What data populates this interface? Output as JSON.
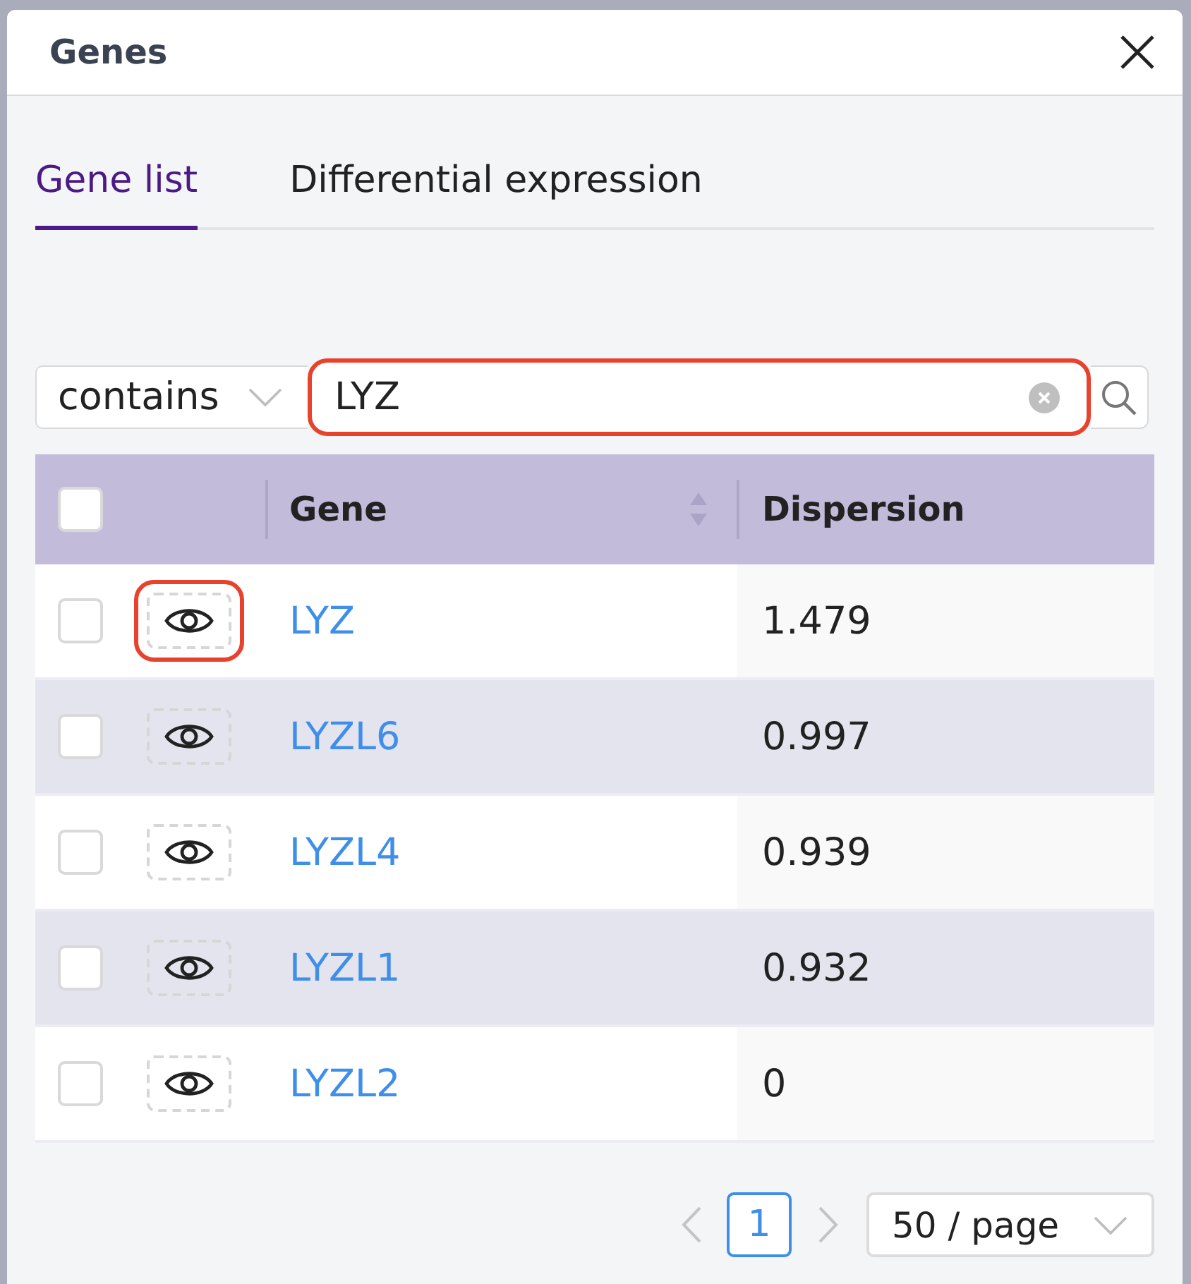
{
  "dialog": {
    "title": "Genes"
  },
  "tabs": [
    {
      "label": "Gene list",
      "selected": true
    },
    {
      "label": "Differential expression",
      "selected": false
    }
  ],
  "filter": {
    "operator": "contains",
    "query": "LYZ",
    "highlighted": true
  },
  "table": {
    "all_checked": false,
    "columns": [
      {
        "label": "Gene",
        "sortable": true
      },
      {
        "label": "Dispersion",
        "sortable": false
      }
    ],
    "rows": [
      {
        "checked": false,
        "highlighted": true,
        "gene": "LYZ",
        "dispersion": "1.479"
      },
      {
        "checked": false,
        "highlighted": false,
        "gene": "LYZL6",
        "dispersion": "0.997"
      },
      {
        "checked": false,
        "highlighted": false,
        "gene": "LYZL4",
        "dispersion": "0.939"
      },
      {
        "checked": false,
        "highlighted": false,
        "gene": "LYZL1",
        "dispersion": "0.932"
      },
      {
        "checked": false,
        "highlighted": false,
        "gene": "LYZL2",
        "dispersion": "0"
      }
    ]
  },
  "pagination": {
    "pages": [
      {
        "label": "1",
        "selected": true
      }
    ],
    "page_size": "50 / page"
  }
}
